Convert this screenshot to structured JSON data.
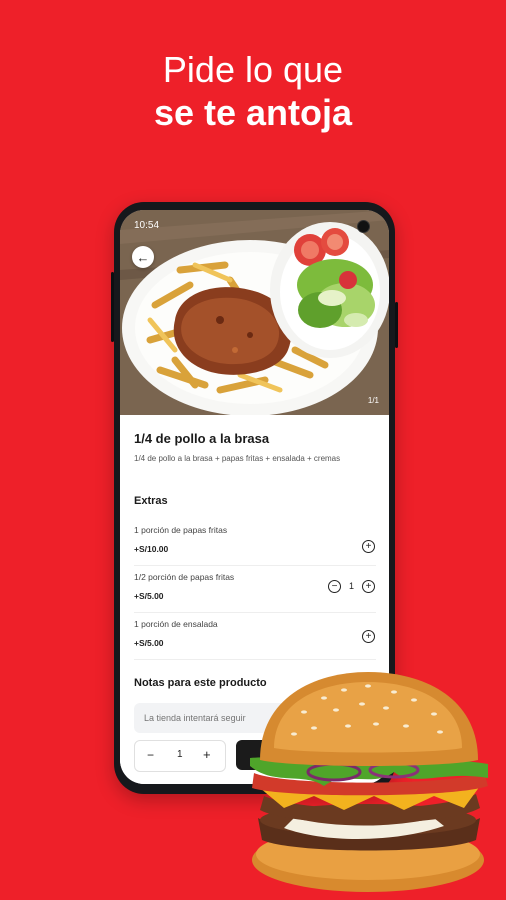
{
  "headline": {
    "line1": "Pide lo que",
    "line2": "se te antoja"
  },
  "status_bar": {
    "time": "10:54"
  },
  "gallery": {
    "counter": "1/1"
  },
  "product": {
    "title": "1/4 de pollo a la brasa",
    "description": "1/4 de pollo a la brasa + papas fritas + ensalada + cremas"
  },
  "extras": {
    "heading": "Extras",
    "items": [
      {
        "name": "1 porción de papas fritas",
        "price": "+S/10.00"
      },
      {
        "name": "1/2 porción de papas fritas",
        "price": "+S/5.00",
        "quantity": "1"
      },
      {
        "name": "1 porción de ensalada",
        "price": "+S/5.00"
      }
    ]
  },
  "notes": {
    "heading": "Notas para este producto",
    "placeholder": "La tienda intentará seguir"
  },
  "cart": {
    "minus": "−",
    "quantity": "1",
    "plus": "+"
  },
  "icons": {
    "back": "arrow-left-icon",
    "add": "plus-circle-icon",
    "remove": "minus-circle-icon"
  },
  "colors": {
    "brand_red": "#EE2029",
    "button_dark": "#1b1b1b"
  }
}
